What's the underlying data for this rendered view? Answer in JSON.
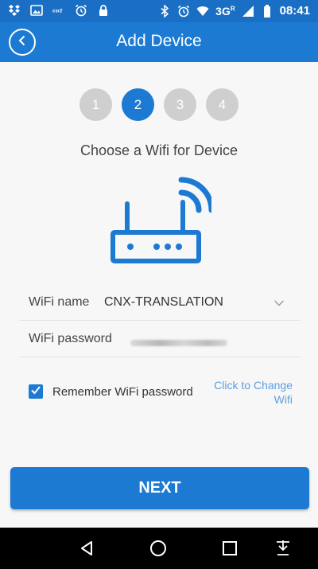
{
  "status_bar": {
    "network": "3G",
    "network_superscript": "R",
    "time": "08:41"
  },
  "app_bar": {
    "title": "Add Device"
  },
  "steps": [
    {
      "label": "1",
      "active": false
    },
    {
      "label": "2",
      "active": true
    },
    {
      "label": "3",
      "active": false
    },
    {
      "label": "4",
      "active": false
    }
  ],
  "heading": "Choose a Wifi for Device",
  "form": {
    "wifi_name_label": "WiFi name",
    "wifi_name_value": "CNX-TRANSLATION",
    "wifi_password_label": "WiFi password",
    "remember_label": "Remember WiFi password",
    "remember_checked": true,
    "change_wifi_link": "Click to Change Wifi"
  },
  "next_button": "NEXT",
  "colors": {
    "primary": "#1d7ad3",
    "status_bar": "#1a6fc4",
    "step_inactive": "#cfcfcf",
    "link": "#5c9ee0"
  },
  "icons": [
    "dropbox-icon",
    "image-icon",
    "cs2-icon",
    "alarm-icon",
    "lock-icon",
    "bluetooth-icon",
    "alarm-icon",
    "wifi-icon",
    "signal-icon",
    "battery-icon",
    "back-icon",
    "router-icon",
    "chevron-down-icon",
    "check-icon",
    "nav-back-icon",
    "nav-home-icon",
    "nav-recents-icon",
    "nav-notifications-icon"
  ]
}
